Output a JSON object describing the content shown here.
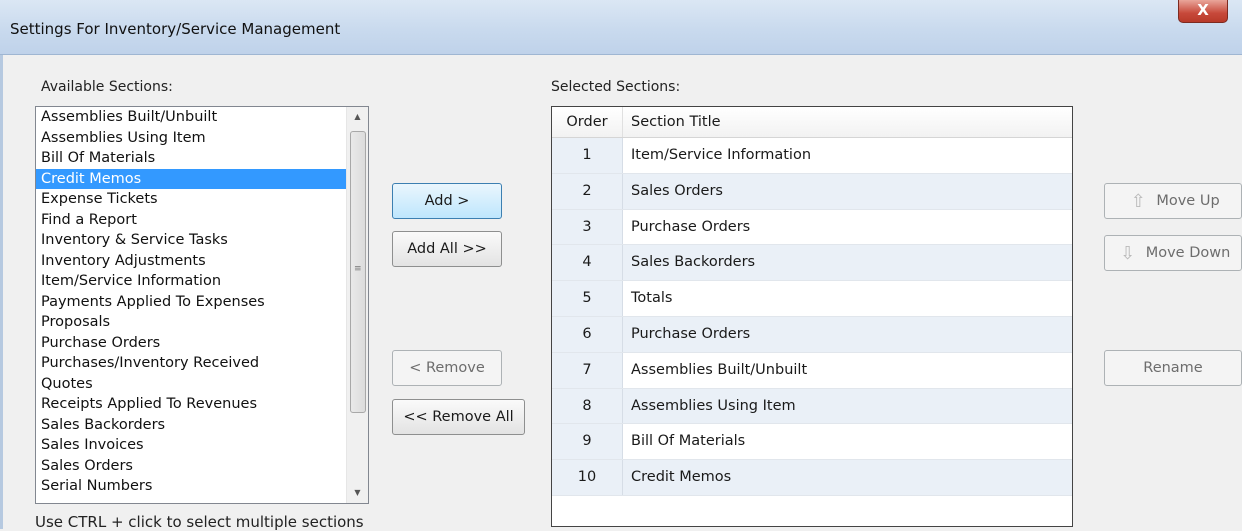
{
  "window": {
    "title": "Settings For Inventory/Service Management",
    "close_label": "X"
  },
  "available": {
    "label": "Available Sections:",
    "items": [
      "Assemblies Built/Unbuilt",
      "Assemblies Using Item",
      "Bill Of Materials",
      "Credit Memos",
      "Expense Tickets",
      "Find a Report",
      "Inventory & Service Tasks",
      "Inventory Adjustments",
      "Item/Service Information",
      "Payments Applied To Expenses",
      "Proposals",
      "Purchase Orders",
      "Purchases/Inventory Received",
      "Quotes",
      "Receipts Applied To Revenues",
      "Sales Backorders",
      "Sales Invoices",
      "Sales Orders",
      "Serial Numbers"
    ],
    "selected_index": 3,
    "hint": "Use CTRL + click to select multiple sections"
  },
  "buttons": {
    "add": "Add >",
    "add_all": "Add All >>",
    "remove": "< Remove",
    "remove_all": "<< Remove All",
    "move_up": "Move Up",
    "move_down": "Move Down",
    "rename": "Rename"
  },
  "selected": {
    "label": "Selected Sections:",
    "columns": [
      "Order",
      "Section Title"
    ],
    "rows": [
      {
        "order": "1",
        "title": "Item/Service Information"
      },
      {
        "order": "2",
        "title": "Sales Orders"
      },
      {
        "order": "3",
        "title": "Purchase Orders"
      },
      {
        "order": "4",
        "title": "Sales Backorders"
      },
      {
        "order": "5",
        "title": "Totals"
      },
      {
        "order": "6",
        "title": "Purchase Orders"
      },
      {
        "order": "7",
        "title": "Assemblies Built/Unbuilt"
      },
      {
        "order": "8",
        "title": "Assemblies Using Item"
      },
      {
        "order": "9",
        "title": "Bill Of Materials"
      },
      {
        "order": "10",
        "title": "Credit Memos"
      }
    ]
  },
  "icons": {
    "move_up": "arrow-up-icon",
    "move_down": "arrow-down-icon",
    "scroll_up": "triangle-up-icon",
    "scroll_down": "triangle-down-icon"
  },
  "colors": {
    "selection": "#3399ff",
    "row_alt": "#eaf0f7",
    "close_button": "#c7493a"
  }
}
